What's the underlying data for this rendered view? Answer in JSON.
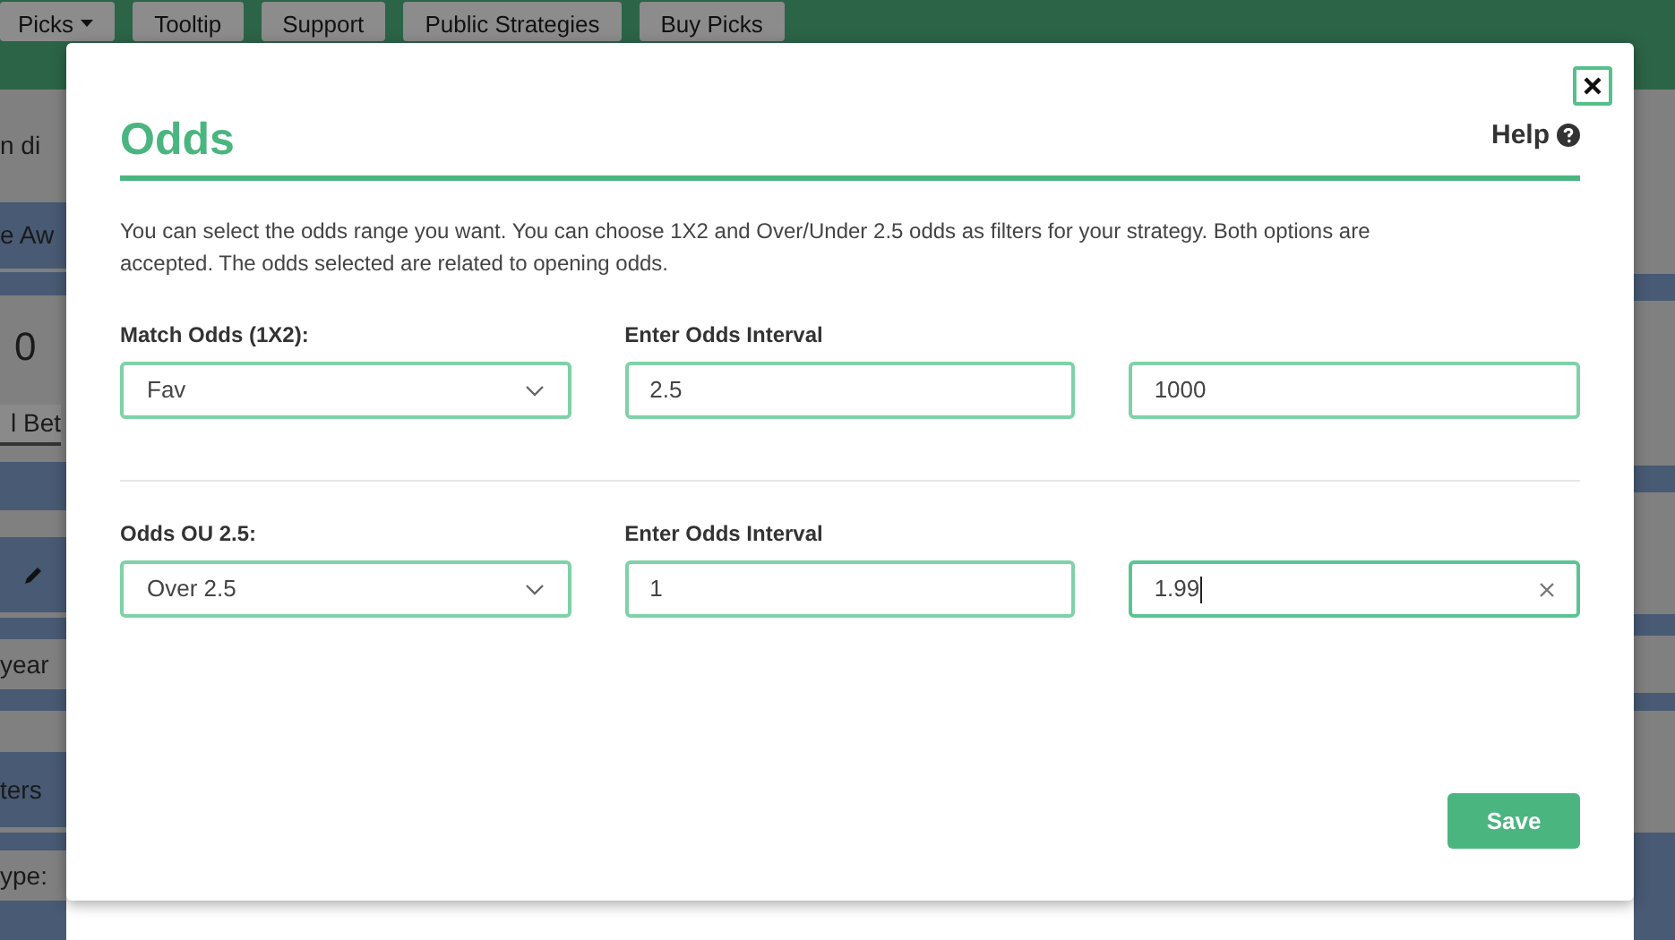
{
  "nav_tabs": [
    {
      "label": "Picks",
      "dropdown": true
    },
    {
      "label": "Tooltip",
      "dropdown": false
    },
    {
      "label": "Support",
      "dropdown": false
    },
    {
      "label": "Public Strategies",
      "dropdown": false
    },
    {
      "label": "Buy Picks",
      "dropdown": false
    }
  ],
  "side_items": [
    {
      "kind": "text",
      "text": "n di"
    },
    {
      "kind": "text",
      "text": "e Aw"
    },
    {
      "kind": "big",
      "text": "0"
    },
    {
      "kind": "boxed",
      "text": "l Bet"
    },
    {
      "kind": "pencil"
    },
    {
      "kind": "text",
      "text": "year"
    },
    {
      "kind": "text",
      "text": "ters"
    },
    {
      "kind": "text",
      "text": "ype:"
    }
  ],
  "dialog": {
    "title": "Odds",
    "help": "Help",
    "description": "You can select the odds range you want. You can choose 1X2 and Over/Under 2.5 odds as filters for your strategy. Both options are accepted. The odds selected are related to opening odds.",
    "rows": [
      {
        "label": "Match Odds (1X2):",
        "select_value": "Fav",
        "interval_label": "Enter Odds Interval",
        "min": "2.5",
        "max": "1000",
        "focused": false
      },
      {
        "label": "Odds OU 2.5:",
        "select_value": "Over 2.5",
        "interval_label": "Enter Odds Interval",
        "min": "1",
        "max": "1.99",
        "focused": true
      }
    ],
    "save": "Save"
  }
}
